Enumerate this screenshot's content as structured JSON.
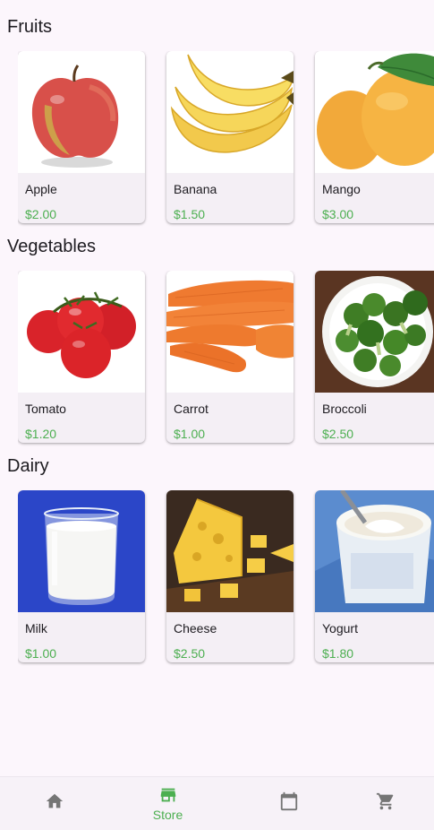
{
  "sections": [
    {
      "title": "Fruits",
      "items": [
        {
          "name": "Apple",
          "price": "$2.00"
        },
        {
          "name": "Banana",
          "price": "$1.50"
        },
        {
          "name": "Mango",
          "price": "$3.00"
        }
      ]
    },
    {
      "title": "Vegetables",
      "items": [
        {
          "name": "Tomato",
          "price": "$1.20"
        },
        {
          "name": "Carrot",
          "price": "$1.00"
        },
        {
          "name": "Broccoli",
          "price": "$2.50"
        }
      ]
    },
    {
      "title": "Dairy",
      "items": [
        {
          "name": "Milk",
          "price": "$1.00"
        },
        {
          "name": "Cheese",
          "price": "$2.50"
        },
        {
          "name": "Yogurt",
          "price": "$1.80"
        }
      ]
    }
  ],
  "bottom_nav": {
    "active_label": "Store",
    "items": [
      {
        "icon": "home-icon"
      },
      {
        "icon": "store-icon",
        "label": "Store",
        "active": true
      },
      {
        "icon": "calendar-icon"
      },
      {
        "icon": "cart-icon"
      }
    ]
  },
  "colors": {
    "accent": "#4caf50",
    "background": "#fcf6fc",
    "card": "#f4eff5",
    "inactive_icon": "#757575"
  }
}
